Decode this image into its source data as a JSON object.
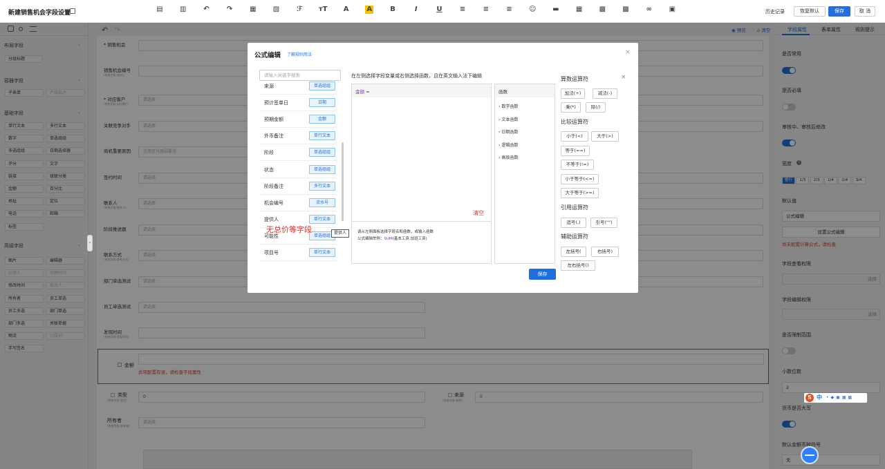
{
  "header": {
    "title": "新建销售机会字段设置",
    "history": "历史记录",
    "reset": "恢复默认",
    "save": "保存",
    "cancel": "取 消"
  },
  "left": {
    "sections": [
      "布局字段",
      "容器字段",
      "基础字段",
      "高级字段"
    ],
    "layout_items": [
      "分组标题"
    ],
    "container_items": [
      "子表单",
      "严格描述"
    ],
    "basic_items": [
      "单行文本",
      "多行文本",
      "数字",
      "单选组组",
      "多选组组",
      "日期选择器",
      "评分",
      "文字",
      "链接",
      "级联分类",
      "金额",
      "百分比",
      "地址",
      "定位",
      "电话",
      "邮箱",
      "标签"
    ],
    "advanced_items": [
      "图片",
      "编辑器",
      "创建人",
      "创建时间",
      "修改时间",
      "修改人",
      "所有者",
      "员工单选",
      "员工多选",
      "部门单选",
      "部门多选",
      "关联单据",
      "物流",
      "归属地",
      "手写签名"
    ]
  },
  "canvas": {
    "toolbar": {
      "preview": "预览",
      "clear": "清空"
    },
    "fields": [
      {
        "label": "* 销售机会",
        "sub": "",
        "value": ""
      },
      {
        "label": "销售机会编号",
        "sub": "(系统字段-流水)",
        "value": ""
      },
      {
        "label": "* 对应客户",
        "sub": "(系统字段-对应客户)",
        "value": "请选择"
      },
      {
        "label": "关联竞争对手",
        "sub": "",
        "value": "请选择"
      },
      {
        "label": "商机重要原因",
        "sub": "",
        "value": "注意区分原因要点"
      },
      {
        "label": "签约时间",
        "sub": "",
        "value": "请选择"
      },
      {
        "label": "联系人",
        "sub": "(系统字段-联系人)",
        "value": "请选择"
      },
      {
        "label": "阶段推进器",
        "sub": "",
        "value": "请选择"
      },
      {
        "label": "联系方式",
        "sub": "(系统字段-联系方式)",
        "value": "请选择"
      },
      {
        "label": "部门单选测试",
        "sub": "",
        "value": "请选择"
      },
      {
        "label": "员工单选测试",
        "sub": "",
        "value": "请选择"
      },
      {
        "label": "发现时间",
        "sub": "(系统字段-发现时间)",
        "value": ""
      }
    ],
    "amount_label": "金额",
    "amount_error": "此项配置有误，请检查字段属性",
    "type_label": "类型",
    "type_sub": "(系统字段-类型)",
    "type_value": "0",
    "source_label": "来源",
    "source_sub": "(系统字段-来源)",
    "source_value": "0",
    "owner_label": "所有者",
    "owner_sub": "(系统字段-所有者)",
    "owner_value": "请选择"
  },
  "right": {
    "tabs": [
      "字段属性",
      "表单属性",
      "规则提示"
    ],
    "common": "是否常用",
    "required": "是否必填",
    "editable": "审核中、审核后修改",
    "width": "宽度",
    "width_opts": [
      "整行",
      "1/3",
      "2/3",
      "1/4",
      "2/4",
      "3/4"
    ],
    "default": "默认值",
    "default_sel": "公式编辑",
    "set_formula": "设置公式编辑",
    "formula_err": "尚未配置计算公式，请检查",
    "view_perm": "字段查看权限",
    "select": "选择",
    "edit_perm": "字段编辑权限",
    "limit": "是否限制范围",
    "decimals": "小数位数",
    "decimals_val": "2",
    "capital": "货币是否大写",
    "currency": "默认金额币种符号",
    "currency_val": "无"
  },
  "modal": {
    "title": "公式编辑",
    "help_link": "了解规则用法",
    "search_placeholder": "请输入关键字搜索",
    "hint": "在左侧选择字段变量或右侧选择函数，且在英文输入法下编辑",
    "formula_prefix": "金额",
    "formula_eq": "=",
    "clear": "清空",
    "variables": [
      {
        "name": "来源",
        "type": "单选组组"
      },
      {
        "name": "预计签单日",
        "type": "日期"
      },
      {
        "name": "预期金额",
        "type": "金额"
      },
      {
        "name": "外币备注",
        "type": "单行文本"
      },
      {
        "name": "阶段",
        "type": "单选组组"
      },
      {
        "name": "状态",
        "type": "单选组组"
      },
      {
        "name": "阶段备注",
        "type": "多行文本"
      },
      {
        "name": "机会编号",
        "type": "流水号"
      },
      {
        "name": "提供人",
        "type": "单行文本"
      },
      {
        "name": "可能性",
        "type": "单选组组"
      },
      {
        "name": "项目号",
        "type": "单行文本"
      }
    ],
    "overlay_text": "无总价等字段",
    "tooltip": "提供人",
    "functions_head": "函数",
    "functions": [
      "数学函数",
      "文本函数",
      "日期函数",
      "逻辑函数",
      "高级函数"
    ],
    "instruction_1": "请从左侧面板选择字段名和函数，或输入函数",
    "instruction_2_prefix": "公式编辑举例：",
    "instruction_2_fn": "SUM",
    "instruction_2_rest": "(基本工资,加班工资)",
    "save": "保存",
    "op_groups": [
      {
        "title": "算数运算符",
        "ops": [
          "加法(+)",
          "减法(-)",
          "乘(*)",
          "除(/)"
        ]
      },
      {
        "title": "比较运算符",
        "ops": [
          "小于(<)",
          "大于(>)",
          "等于(==)",
          "不等于(!=)",
          "小于等于(<=)",
          "大于等于(>=)"
        ]
      },
      {
        "title": "引用运算符",
        "ops": [
          "逗号(,)",
          "引号(\"\")"
        ]
      },
      {
        "title": "辅助运算符",
        "ops": [
          "左括号(",
          "右括号)",
          "左右括号()"
        ]
      }
    ]
  },
  "ime": {
    "label": "中"
  },
  "colors": {
    "primary": "#1f6fe0",
    "error": "#e0362a",
    "purple": "#8a2ec8"
  }
}
